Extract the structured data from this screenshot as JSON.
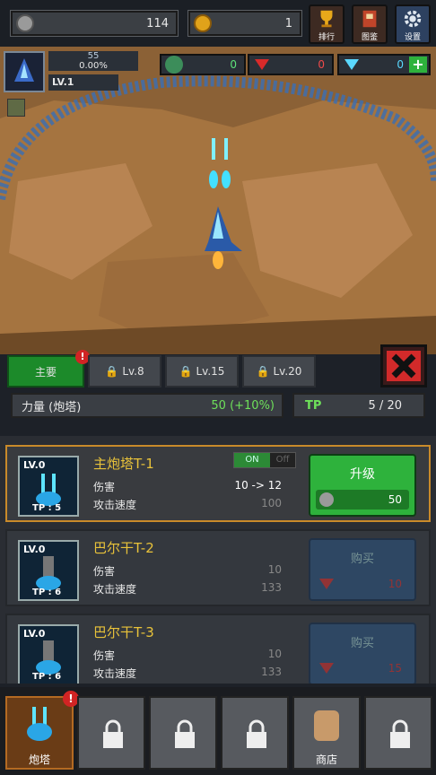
{
  "resources": {
    "silver": "114",
    "gold": "1",
    "globe": "0",
    "ruby": "0",
    "diamond": "0"
  },
  "topbuttons": {
    "rank": "排行",
    "codex": "图鉴",
    "settings": "设置"
  },
  "pilot": {
    "level": "LV.1",
    "xp_percent": "0.00%",
    "rank_num": "55"
  },
  "tabs": {
    "main": "主要",
    "lock1": "Lv.8",
    "lock2": "Lv.15",
    "lock3": "Lv.20"
  },
  "power": {
    "label": "力量 (炮塔)",
    "value": "50 (+10%)"
  },
  "tp": {
    "label": "TP",
    "value": "5 / 20"
  },
  "cards": [
    {
      "level": "LV.0",
      "tp": "TP : 5",
      "name": "主炮塔T-1",
      "dmg_label": "伤害",
      "dmg": "10 -> 12",
      "spd_label": "攻击速度",
      "spd": "100",
      "toggle_on": "ON",
      "toggle_off": "Off",
      "btn": "升级",
      "cost": "50"
    },
    {
      "level": "LV.0",
      "tp": "TP : 6",
      "name": "巴尔干T-2",
      "dmg_label": "伤害",
      "dmg": "10",
      "spd_label": "攻击速度",
      "spd": "133",
      "btn": "购买",
      "cost": "10"
    },
    {
      "level": "LV.0",
      "tp": "TP : 6",
      "name": "巴尔干T-3",
      "dmg_label": "伤害",
      "dmg": "10",
      "spd_label": "攻击速度",
      "spd": "133",
      "btn": "购买",
      "cost": "15"
    }
  ],
  "bottom": {
    "turret": "炮塔",
    "shop": "商店"
  },
  "colors": {
    "accent_green": "#2eb23c",
    "gold_text": "#e8c23a",
    "selected_border": "#c98a2a"
  }
}
